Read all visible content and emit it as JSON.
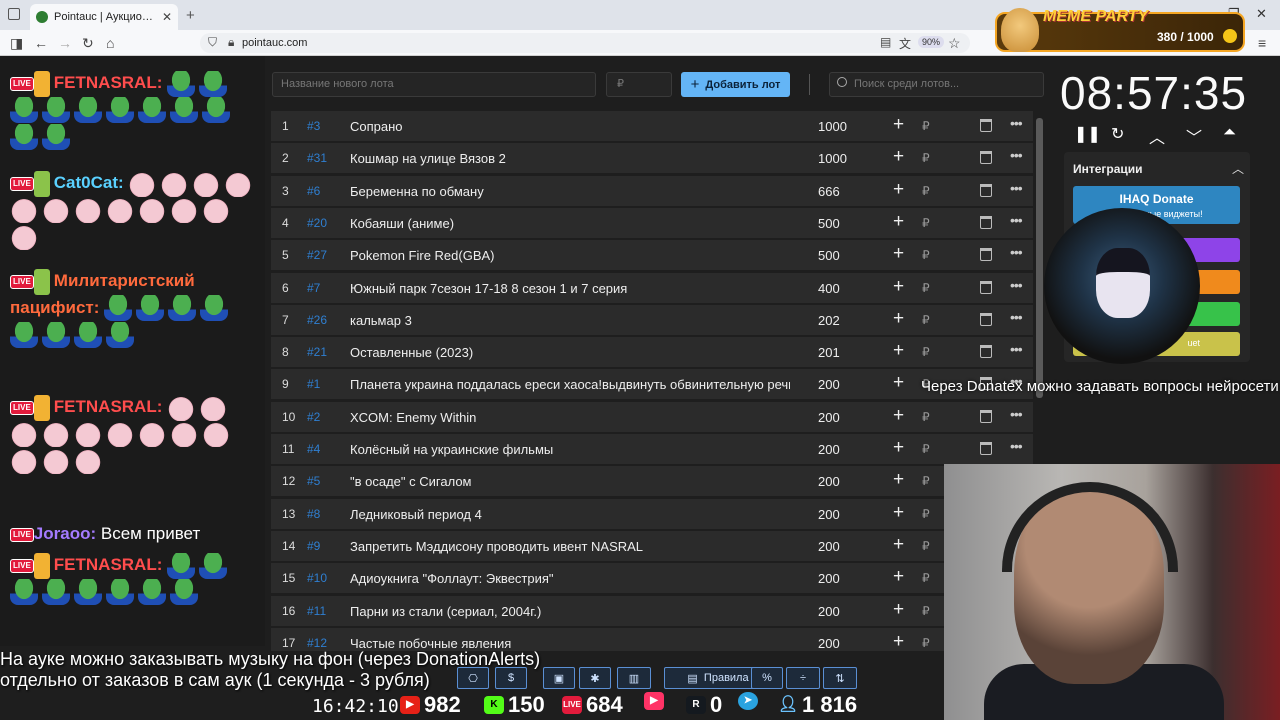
{
  "browser": {
    "tab_title": "Pointauc | Аукцион для стримеров",
    "tab_close": "✕",
    "new_tab": "+",
    "url": "pointauc.com",
    "zoom": "90%"
  },
  "meme_party": {
    "title": "MEME PARTY",
    "points": "380 / 1000"
  },
  "chat": [
    {
      "user": "FETNASRAL:",
      "color": "#ff4d4d",
      "text": ""
    },
    {
      "user": "Cat0Cat:",
      "color": "#5ad1ff",
      "text": ""
    },
    {
      "user": "Милитаристский пацифист:",
      "color": "#ff6a3d",
      "text": ""
    },
    {
      "user": "FETNASRAL:",
      "color": "#ff4d4d",
      "text": ""
    },
    {
      "user": "Joraoo:",
      "color": "#a47bff",
      "text": "Всем привет"
    },
    {
      "user": "FETNASRAL:",
      "color": "#ff4d4d",
      "text": ""
    }
  ],
  "auction": {
    "new_lot_placeholder": "Название нового лота",
    "amount_placeholder": "₽",
    "add_lot_label": "Добавить лот",
    "search_placeholder": "Поиск среди лотов...",
    "currency_symbol": "₽",
    "lots": [
      {
        "n": "1",
        "id": "#3",
        "name": "Сопрано",
        "amount": "1000"
      },
      {
        "n": "2",
        "id": "#31",
        "name": "Кошмар на улице Вязов 2",
        "amount": "1000"
      },
      {
        "n": "3",
        "id": "#6",
        "name": "Беременна по обману",
        "amount": "666"
      },
      {
        "n": "4",
        "id": "#20",
        "name": "Кобаяши (аниме)",
        "amount": "500"
      },
      {
        "n": "5",
        "id": "#27",
        "name": "Pokemon Fire Red(GBA)",
        "amount": "500"
      },
      {
        "n": "6",
        "id": "#7",
        "name": "Южный парк 7сезон 17-18 8 сезон 1 и 7 серия",
        "amount": "400"
      },
      {
        "n": "7",
        "id": "#26",
        "name": "кальмар 3",
        "amount": "202"
      },
      {
        "n": "8",
        "id": "#21",
        "name": "Оставленные (2023)",
        "amount": "201"
      },
      {
        "n": "9",
        "id": "#1",
        "name": "Планета украина поддалась ереси хаоса!выдвинуть обвинительную речь! по",
        "amount": "200"
      },
      {
        "n": "10",
        "id": "#2",
        "name": "XCOM: Enemy Within",
        "amount": "200"
      },
      {
        "n": "11",
        "id": "#4",
        "name": "Колёсный на украинские фильмы",
        "amount": "200"
      },
      {
        "n": "12",
        "id": "#5",
        "name": "\"в осаде\" с Сигалом",
        "amount": "200"
      },
      {
        "n": "13",
        "id": "#8",
        "name": "Ледниковый период 4",
        "amount": "200"
      },
      {
        "n": "14",
        "id": "#9",
        "name": "Запретить Мэддисону проводить ивент NASRAL",
        "amount": "200"
      },
      {
        "n": "15",
        "id": "#10",
        "name": "Адиоукнига \"Фоллаут: Эквестрия\"",
        "amount": "200"
      },
      {
        "n": "16",
        "id": "#11",
        "name": "Парни из стали (сериал, 2004г.)",
        "amount": "200"
      },
      {
        "n": "17",
        "id": "#12",
        "name": "Частые побочные явления",
        "amount": "200"
      }
    ]
  },
  "timer": {
    "value": "08:57:35"
  },
  "integrations": {
    "title": "Интеграции",
    "ihaq_label": "IHAQ Donate",
    "ihaq_sub": "Уникальные виджеты!",
    "bar_colors": [
      "#8e44e8",
      "#f08a1c",
      "#37c24a",
      "#c9c24a"
    ],
    "bar4_text": "uet"
  },
  "overlay_text": "Через Donatex можно задавать вопросы нейросети",
  "ticker": {
    "line1": "На ауке можно заказывать музыку на фон (через DonationAlerts)",
    "line2": "отдельно от заказов в сам аук (1 секунда - 3 рубля)"
  },
  "toolbar": {
    "rules_label": "Правила",
    "percent_label": "%"
  },
  "stats": {
    "clock": "16:42:10",
    "youtube": "982",
    "kick": "150",
    "live": "684",
    "vk": "",
    "rutube": "0",
    "telegram": "",
    "viewers": "1 816"
  }
}
